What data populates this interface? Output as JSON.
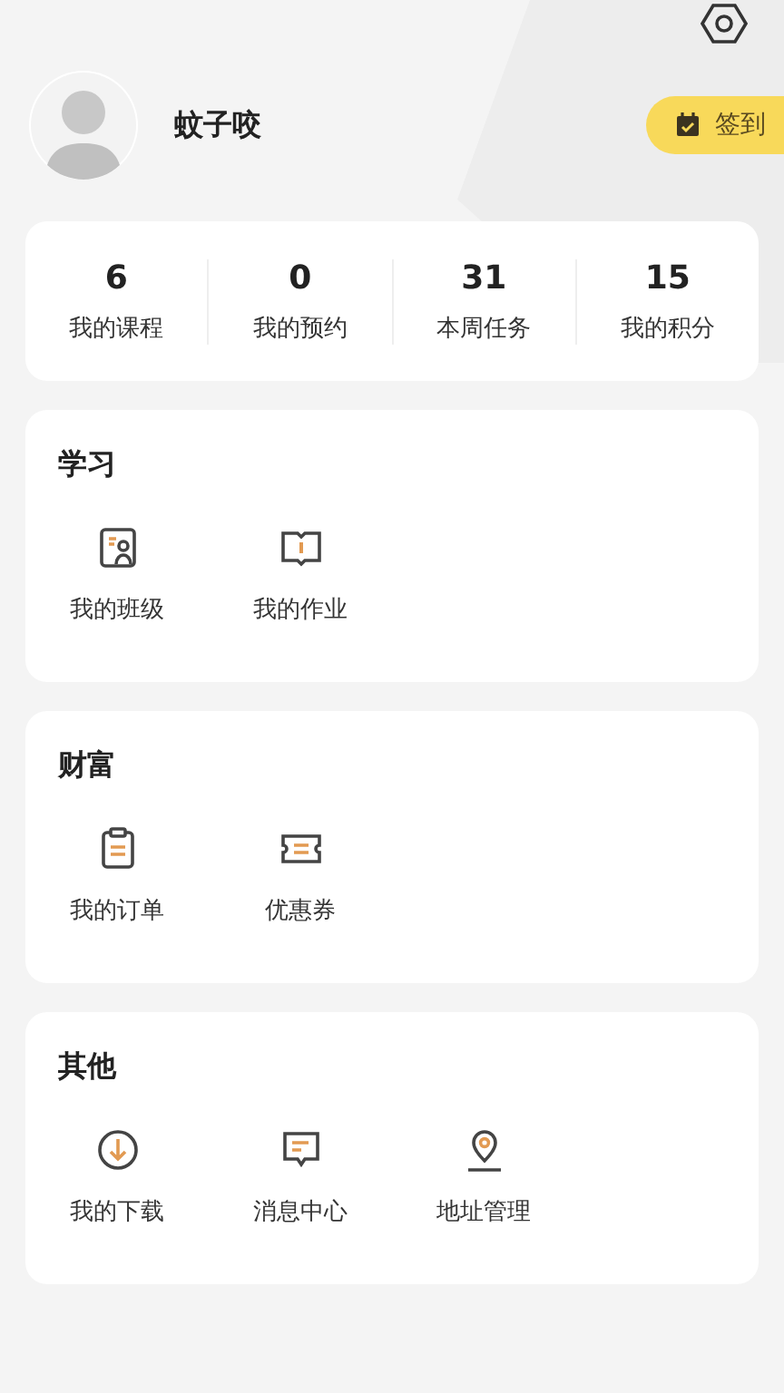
{
  "profile": {
    "name": "蚊子咬",
    "checkin_label": "签到"
  },
  "stats": [
    {
      "value": "6",
      "label": "我的课程"
    },
    {
      "value": "0",
      "label": "我的预约"
    },
    {
      "value": "31",
      "label": "本周任务"
    },
    {
      "value": "15",
      "label": "我的积分"
    }
  ],
  "sections": [
    {
      "title": "学习",
      "items": [
        "我的班级",
        "我的作业"
      ]
    },
    {
      "title": "财富",
      "items": [
        "我的订单",
        "优惠券"
      ]
    },
    {
      "title": "其他",
      "items": [
        "我的下载",
        "消息中心",
        "地址管理"
      ]
    }
  ]
}
